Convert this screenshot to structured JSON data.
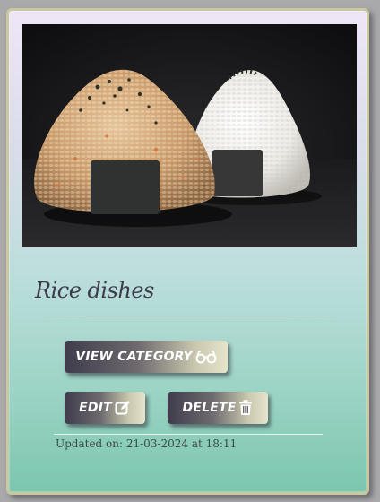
{
  "card": {
    "image_alt": "Two onigiri rice balls wrapped with nori on a dark background",
    "title": "Rice dishes",
    "buttons": {
      "view_label": "VIEW CATEGORY",
      "edit_label": "EDIT",
      "delete_label": "DELETE"
    },
    "updated_text": "Updated on: 21-03-2024 at 18:11"
  },
  "icons": {
    "view": "glasses-icon",
    "edit": "edit-icon",
    "delete": "trash-icon"
  }
}
